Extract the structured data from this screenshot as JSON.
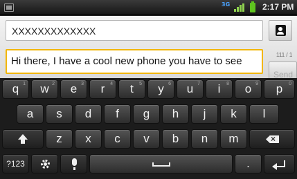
{
  "status_bar": {
    "network_label": "3G",
    "time": "2:17 PM",
    "icons": [
      "notification-icon",
      "network-3g-icon",
      "signal-icon",
      "battery-icon"
    ]
  },
  "compose": {
    "to_value": "XXXXXXXXXXXXX",
    "message_value": "Hi there, I have a cool new phone you have to see",
    "char_counter": "111 / 1",
    "send_label": "Send"
  },
  "keyboard": {
    "row1": [
      {
        "label": "q",
        "hint": "1"
      },
      {
        "label": "w",
        "hint": "2"
      },
      {
        "label": "e",
        "hint": "3"
      },
      {
        "label": "r",
        "hint": "4"
      },
      {
        "label": "t",
        "hint": "5"
      },
      {
        "label": "y",
        "hint": "6"
      },
      {
        "label": "u",
        "hint": "7"
      },
      {
        "label": "i",
        "hint": "8"
      },
      {
        "label": "o",
        "hint": "9"
      },
      {
        "label": "p",
        "hint": "0"
      }
    ],
    "row2": [
      "a",
      "s",
      "d",
      "f",
      "g",
      "h",
      "j",
      "k",
      "l"
    ],
    "row3": [
      "z",
      "x",
      "c",
      "v",
      "b",
      "n",
      "m"
    ],
    "symbols_label": "?123",
    "period_label": "."
  }
}
